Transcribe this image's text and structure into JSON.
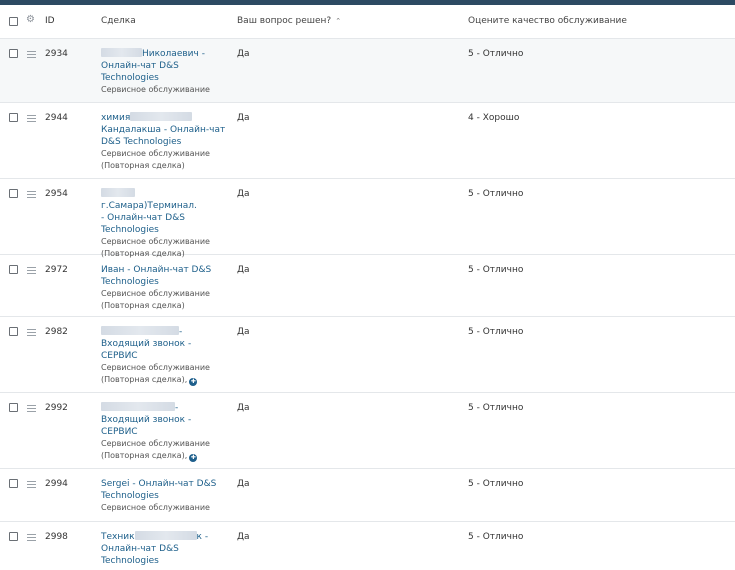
{
  "header": {
    "id": "ID",
    "deal": "Сделка",
    "resolved": "Ваш вопрос решен?",
    "quality": "Оцените качество обслуживание"
  },
  "rows": [
    {
      "id": "2934",
      "deal_line1_suffix": "Николаевич -",
      "deal_lines": [
        "Онлайн-чат D&S",
        "Technologies"
      ],
      "sub": [
        "Сервисное обслуживание"
      ],
      "resolved": "Да",
      "quality": "5 - Отлично"
    },
    {
      "id": "2944",
      "deal_line1_prefix": "химия",
      "deal_lines": [
        "Кандалакша - Онлайн-чат",
        "D&S Technologies"
      ],
      "sub": [
        "Сервисное обслуживание",
        "(Повторная сделка)"
      ],
      "resolved": "Да",
      "quality": "4 - Хорошо"
    },
    {
      "id": "2954",
      "deal_line1_suffix": "г.Самара)Терминал.",
      "deal_lines": [
        "- Онлайн-чат D&S",
        "Technologies"
      ],
      "sub": [
        "Сервисное обслуживание",
        "(Повторная сделка)"
      ],
      "resolved": "Да",
      "quality": "5 - Отлично"
    },
    {
      "id": "2972",
      "deal_lines": [
        "Иван - Онлайн-чат D&S",
        "Technologies"
      ],
      "sub": [
        "Сервисное обслуживание",
        "(Повторная сделка)"
      ],
      "resolved": "Да",
      "quality": "5 - Отлично"
    },
    {
      "id": "2982",
      "deal_line1_suffix": "-",
      "deal_lines": [
        "Входящий звонок -",
        "СЕРВИС"
      ],
      "sub": [
        "Сервисное обслуживание",
        "(Повторная сделка),"
      ],
      "resolved": "Да",
      "quality": "5 - Отлично"
    },
    {
      "id": "2992",
      "deal_line1_suffix": "-",
      "deal_lines": [
        "Входящий звонок -",
        "СЕРВИС"
      ],
      "sub": [
        "Сервисное обслуживание",
        "(Повторная сделка),"
      ],
      "resolved": "Да",
      "quality": "5 - Отлично"
    },
    {
      "id": "2994",
      "deal_lines": [
        "Sergei - Онлайн-чат D&S",
        "Technologies"
      ],
      "sub": [
        "Сервисное обслуживание"
      ],
      "resolved": "Да",
      "quality": "5 - Отлично"
    },
    {
      "id": "2998",
      "deal_line1_prefix": "Техник",
      "deal_line1_suffix": "к -",
      "deal_lines": [
        "Онлайн-чат D&S",
        "Technologies"
      ],
      "sub": [],
      "resolved": "Да",
      "quality": "5 - Отлично"
    }
  ],
  "colors": {
    "link": "#1d5f8a",
    "topbar": "#2d4a63"
  },
  "icons": {
    "gear": "gear-icon",
    "drag": "drag-handle-icon",
    "sort": "sort-asc-icon",
    "info": "info-badge-icon"
  }
}
